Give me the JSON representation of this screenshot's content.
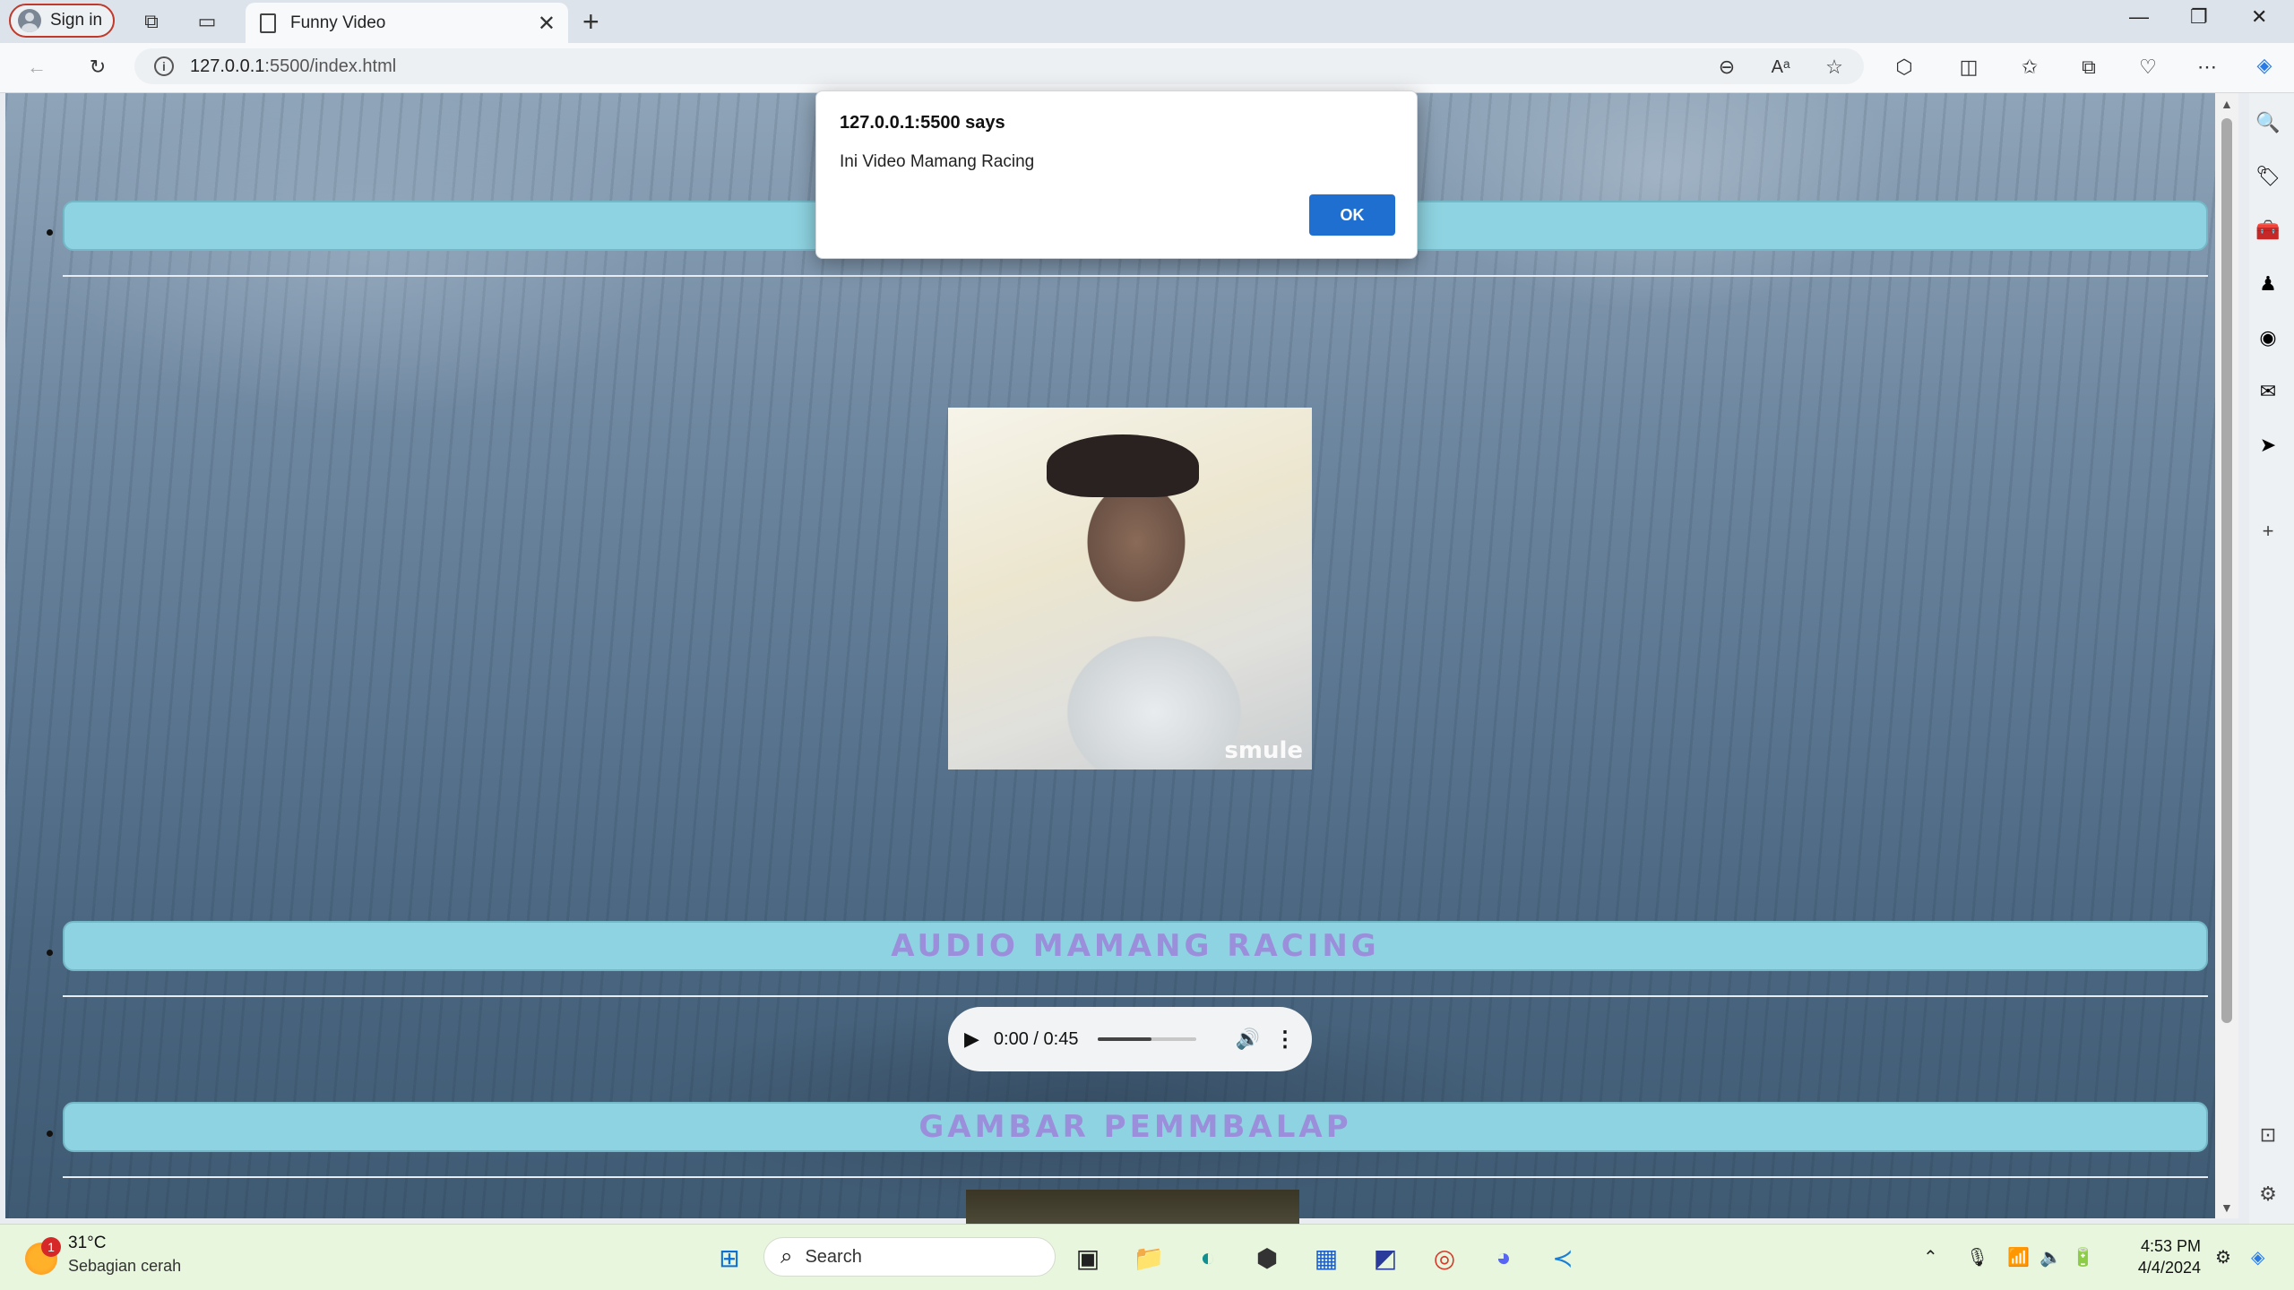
{
  "browser": {
    "signin_label": "Sign in",
    "tab_title": "Funny Video",
    "url_host": "127.0.0.1",
    "url_rest": ":5500/index.html"
  },
  "page": {
    "heading_audio": "AUDIO MAMANG RACING",
    "heading_picture": "GAMBAR PEMMBALAP",
    "video_watermark": "smule",
    "audio_time": "0:00 / 0:45",
    "audio_volume_level": 0.55
  },
  "dialog": {
    "title": "127.0.0.1:5500 says",
    "message": "Ini Video Mamang Racing",
    "ok_label": "OK"
  },
  "taskbar": {
    "weather_temp": "31°C",
    "weather_desc": "Sebagian cerah",
    "weather_badge": "1",
    "search_label": "Search",
    "time": "4:53 PM",
    "date": "4/4/2024"
  }
}
